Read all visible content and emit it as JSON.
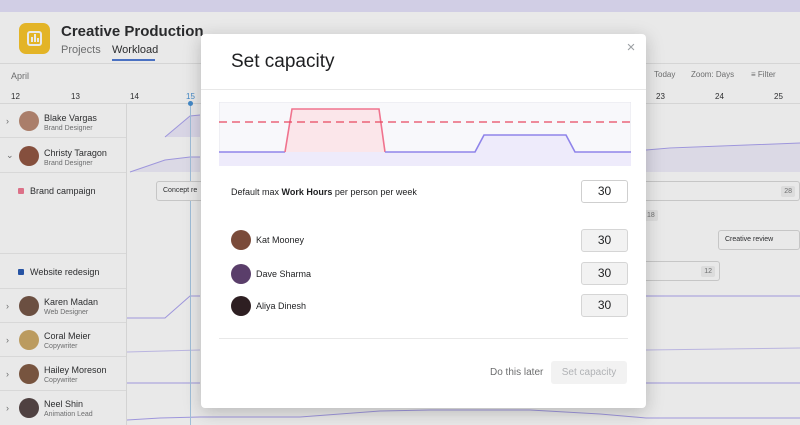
{
  "app": {
    "title": "Creative Production",
    "tabs": [
      {
        "label": "Projects",
        "active": false
      },
      {
        "label": "Workload",
        "active": true
      }
    ],
    "icon_color": "#f8c11c",
    "accent": "#4573d2"
  },
  "toolbar": {
    "today_label": "Today",
    "zoom_label": "Zoom: Days",
    "filter_label": "Filter"
  },
  "timeline": {
    "month": "April",
    "days": [
      "12",
      "13",
      "14",
      "15",
      "23",
      "24",
      "25"
    ],
    "today": "15"
  },
  "people": [
    {
      "name": "Blake Vargas",
      "role": "Brand Designer",
      "avatar_color": "#b5826a"
    },
    {
      "name": "Christy Taragon",
      "role": "Brand Designer",
      "avatar_color": "#8a4a36"
    },
    {
      "name": "Karen Madan",
      "role": "Web Designer",
      "avatar_color": "#6b4a3a"
    },
    {
      "name": "Coral Meier",
      "role": "Copywriter",
      "avatar_color": "#c9a45d"
    },
    {
      "name": "Hailey Moreson",
      "role": "Copywriter",
      "avatar_color": "#7a5138"
    },
    {
      "name": "Neel Shin",
      "role": "Animation Lead",
      "avatar_color": "#4a3a3a"
    }
  ],
  "projects": [
    {
      "name": "Brand campaign",
      "color": "#f0738e"
    },
    {
      "name": "Website redesign",
      "color": "#1a4fad"
    }
  ],
  "tasks": {
    "concept": "Concept re",
    "creative_review": "Creative review",
    "badges": [
      "28",
      "18",
      "12"
    ]
  },
  "modal": {
    "title": "Set capacity",
    "default_label_prefix": "Default max ",
    "default_label_bold": "Work Hours",
    "default_label_suffix": " per person per week",
    "default_value": "30",
    "members": [
      {
        "name": "Kat Mooney",
        "value": "30",
        "avatar_color": "#7a4b3a"
      },
      {
        "name": "Dave Sharma",
        "value": "30",
        "avatar_color": "#5a3e6a"
      },
      {
        "name": "Aliya Dinesh",
        "value": "30",
        "avatar_color": "#2e1f22"
      }
    ],
    "later_label": "Do this later",
    "set_label": "Set capacity",
    "chart_colors": {
      "over": "#f0738e",
      "line": "#8f84ea",
      "limit": "#e8485f",
      "fill": "#eeebfb",
      "over_fill": "#fbe6ea"
    }
  }
}
